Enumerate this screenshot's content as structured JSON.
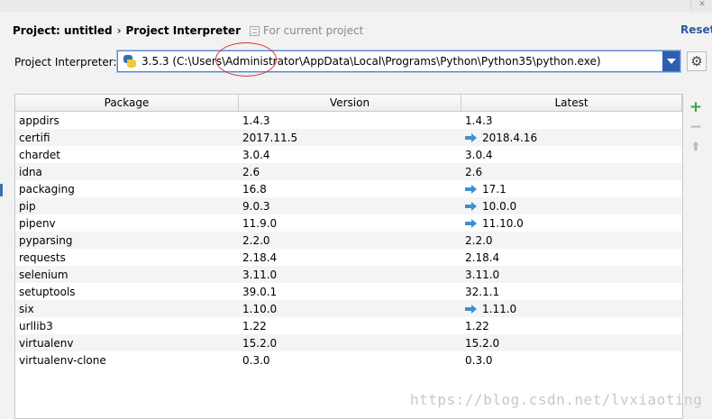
{
  "breadcrumb": {
    "project": "Project: untitled",
    "separator": "›",
    "page": "Project Interpreter",
    "scope_icon": "copy-scope-icon",
    "scope": "For current project"
  },
  "reset_label": "Reset",
  "interpreter": {
    "label": "Project Interpreter:",
    "value": "3.5.3 (C:\\Users\\Administrator\\AppData\\Local\\Programs\\Python\\Python35\\python.exe)",
    "icon": "python-icon"
  },
  "table": {
    "headers": [
      "Package",
      "Version",
      "Latest"
    ],
    "rows": [
      {
        "package": "appdirs",
        "version": "1.4.3",
        "latest": "1.4.3",
        "upgrade": false
      },
      {
        "package": "certifi",
        "version": "2017.11.5",
        "latest": "2018.4.16",
        "upgrade": true
      },
      {
        "package": "chardet",
        "version": "3.0.4",
        "latest": "3.0.4",
        "upgrade": false
      },
      {
        "package": "idna",
        "version": "2.6",
        "latest": "2.6",
        "upgrade": false
      },
      {
        "package": "packaging",
        "version": "16.8",
        "latest": "17.1",
        "upgrade": true
      },
      {
        "package": "pip",
        "version": "9.0.3",
        "latest": "10.0.0",
        "upgrade": true
      },
      {
        "package": "pipenv",
        "version": "11.9.0",
        "latest": "11.10.0",
        "upgrade": true
      },
      {
        "package": "pyparsing",
        "version": "2.2.0",
        "latest": "2.2.0",
        "upgrade": false
      },
      {
        "package": "requests",
        "version": "2.18.4",
        "latest": "2.18.4",
        "upgrade": false
      },
      {
        "package": "selenium",
        "version": "3.11.0",
        "latest": "3.11.0",
        "upgrade": false
      },
      {
        "package": "setuptools",
        "version": "39.0.1",
        "latest": "32.1.1",
        "upgrade": false
      },
      {
        "package": "six",
        "version": "1.10.0",
        "latest": "1.11.0",
        "upgrade": true
      },
      {
        "package": "urllib3",
        "version": "1.22",
        "latest": "1.22",
        "upgrade": false
      },
      {
        "package": "virtualenv",
        "version": "15.2.0",
        "latest": "15.2.0",
        "upgrade": false
      },
      {
        "package": "virtualenv-clone",
        "version": "0.3.0",
        "latest": "0.3.0",
        "upgrade": false
      }
    ]
  },
  "tools": {
    "add": "+",
    "remove": "−",
    "upgrade": "⬆"
  },
  "watermark": "https://blog.csdn.net/lvxiaoting",
  "colors": {
    "accent": "#2d5fb0",
    "add": "#3aa23a",
    "upgrade_arrow": "#3d8fd0",
    "annotation": "#d9302c"
  }
}
